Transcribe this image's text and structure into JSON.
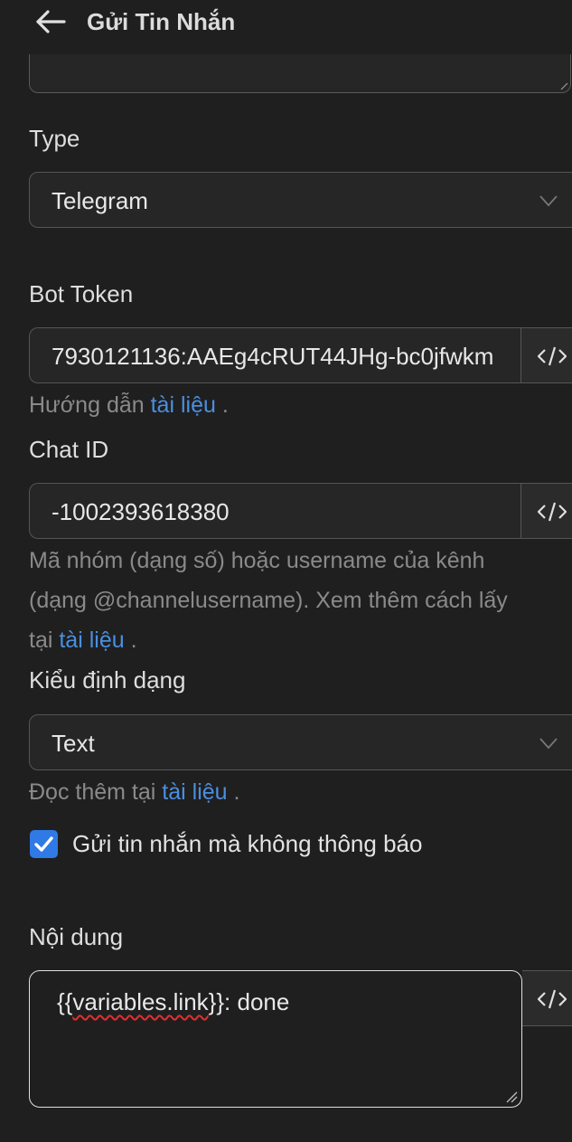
{
  "header": {
    "title": "Gửi Tin Nhắn",
    "back_icon": "arrow-left-icon"
  },
  "type_field": {
    "label": "Type",
    "selected": "Telegram"
  },
  "bot_token": {
    "label": "Bot Token",
    "value": "7930121136:AAEg4cRUT44JHg-bc0jfwkm",
    "helper_prefix": "Hướng dẫn",
    "helper_link": "tài liệu",
    "helper_suffix": "."
  },
  "chat_id": {
    "label": "Chat ID",
    "value": "-1002393618380",
    "helper_line1": "Mã nhóm (dạng số) hoặc username của kênh",
    "helper_line2": "(dạng @channelusername). Xem thêm cách lấy",
    "helper_prefix3": "tại",
    "helper_link": "tài liệu",
    "helper_suffix": "."
  },
  "format_field": {
    "label": "Kiểu định dạng",
    "selected": "Text",
    "helper_prefix": "Đọc thêm tại",
    "helper_link": "tài liệu",
    "helper_suffix": "."
  },
  "silent_checkbox": {
    "label": "Gửi tin nhắn mà không thông báo",
    "checked": true
  },
  "content": {
    "label": "Nội dung",
    "prefix": "{{",
    "variable": "variables.link",
    "suffix": "}}: done"
  },
  "colors": {
    "background": "#1f1f1f",
    "accent": "#2f7ae5",
    "link": "#4a8fe0"
  }
}
